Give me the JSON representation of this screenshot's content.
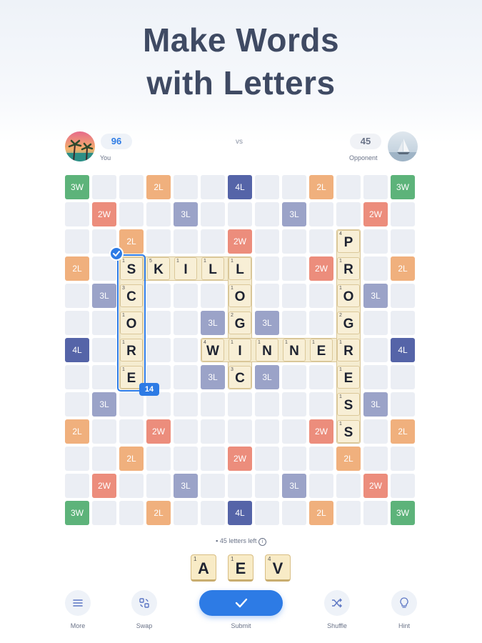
{
  "headline": {
    "line1": "Make Words",
    "line2": "with Letters"
  },
  "players": {
    "you": {
      "score": "96",
      "label": "You"
    },
    "vs": "vs",
    "opponent": {
      "score": "45",
      "label": "Opponent"
    }
  },
  "board": {
    "bonus_labels": [
      "3W",
      "2W",
      "2L",
      "3L",
      "4L"
    ],
    "words": [
      "SKILL",
      "SCORE",
      "LOGIC",
      "WINNER",
      "PROGRESS"
    ],
    "selected_word_score": "14"
  },
  "rack": {
    "letters_left": "45 letters left",
    "tiles": [
      {
        "letter": "A",
        "points": "1"
      },
      {
        "letter": "E",
        "points": "1"
      },
      {
        "letter": "V",
        "points": "4"
      }
    ]
  },
  "toolbar": {
    "more": "More",
    "swap": "Swap",
    "submit": "Submit",
    "shuffle": "Shuffle",
    "hint": "Hint"
  },
  "colors": {
    "accent": "#2d7be5",
    "bonus_3w": "#5db37a",
    "bonus_2w": "#ec8d7c",
    "bonus_2l": "#f0b07d",
    "bonus_3l": "#9ba3c8",
    "bonus_4l": "#5564a8",
    "tile": "#f8efd6"
  }
}
